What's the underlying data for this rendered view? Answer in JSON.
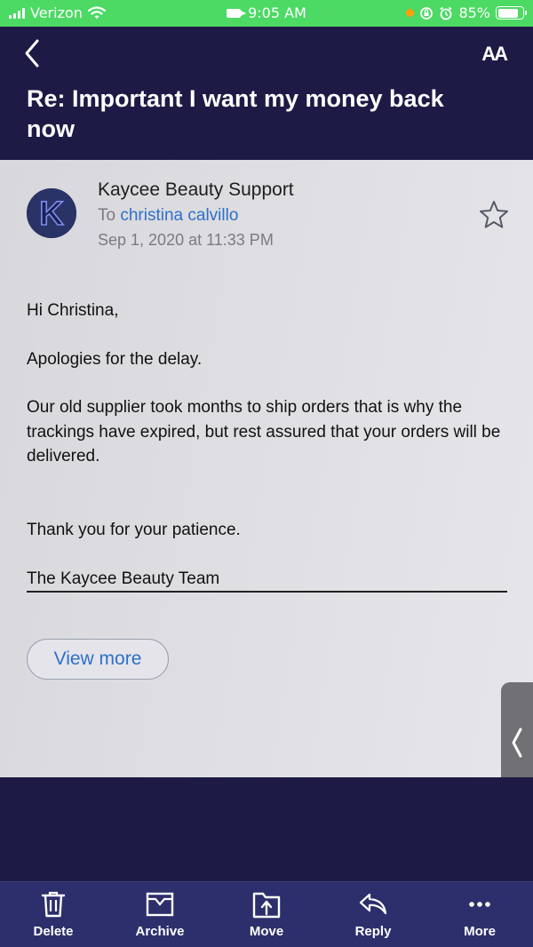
{
  "status_bar": {
    "carrier": "Verizon",
    "time": "9:05 AM",
    "battery": "85%"
  },
  "header": {
    "text_size_label": "AA",
    "subject": "Re: Important I want my money back now"
  },
  "message": {
    "sender": "Kaycee Beauty Support",
    "avatar_letter": "K",
    "to_prefix": "To",
    "recipient": "christina calvillo",
    "date": "Sep 1, 2020 at 11:33 PM",
    "body": [
      "Hi Christina,",
      "Apologies for the delay.",
      "Our old supplier took months to ship orders that is why the trackings have expired, but rest assured that your orders will be delivered.",
      "Thank you for your patience.",
      "The Kaycee Beauty Team"
    ],
    "view_more": "View more"
  },
  "toolbar": {
    "items": [
      {
        "label": "Delete",
        "icon": "trash-icon"
      },
      {
        "label": "Archive",
        "icon": "archive-icon"
      },
      {
        "label": "Move",
        "icon": "move-icon"
      },
      {
        "label": "Reply",
        "icon": "reply-icon"
      },
      {
        "label": "More",
        "icon": "more-icon"
      }
    ]
  },
  "colors": {
    "status_bar": "#4cd964",
    "header_bg": "#1d1a45",
    "toolbar_bg": "#2c2f6b",
    "link": "#2e6fc9"
  }
}
